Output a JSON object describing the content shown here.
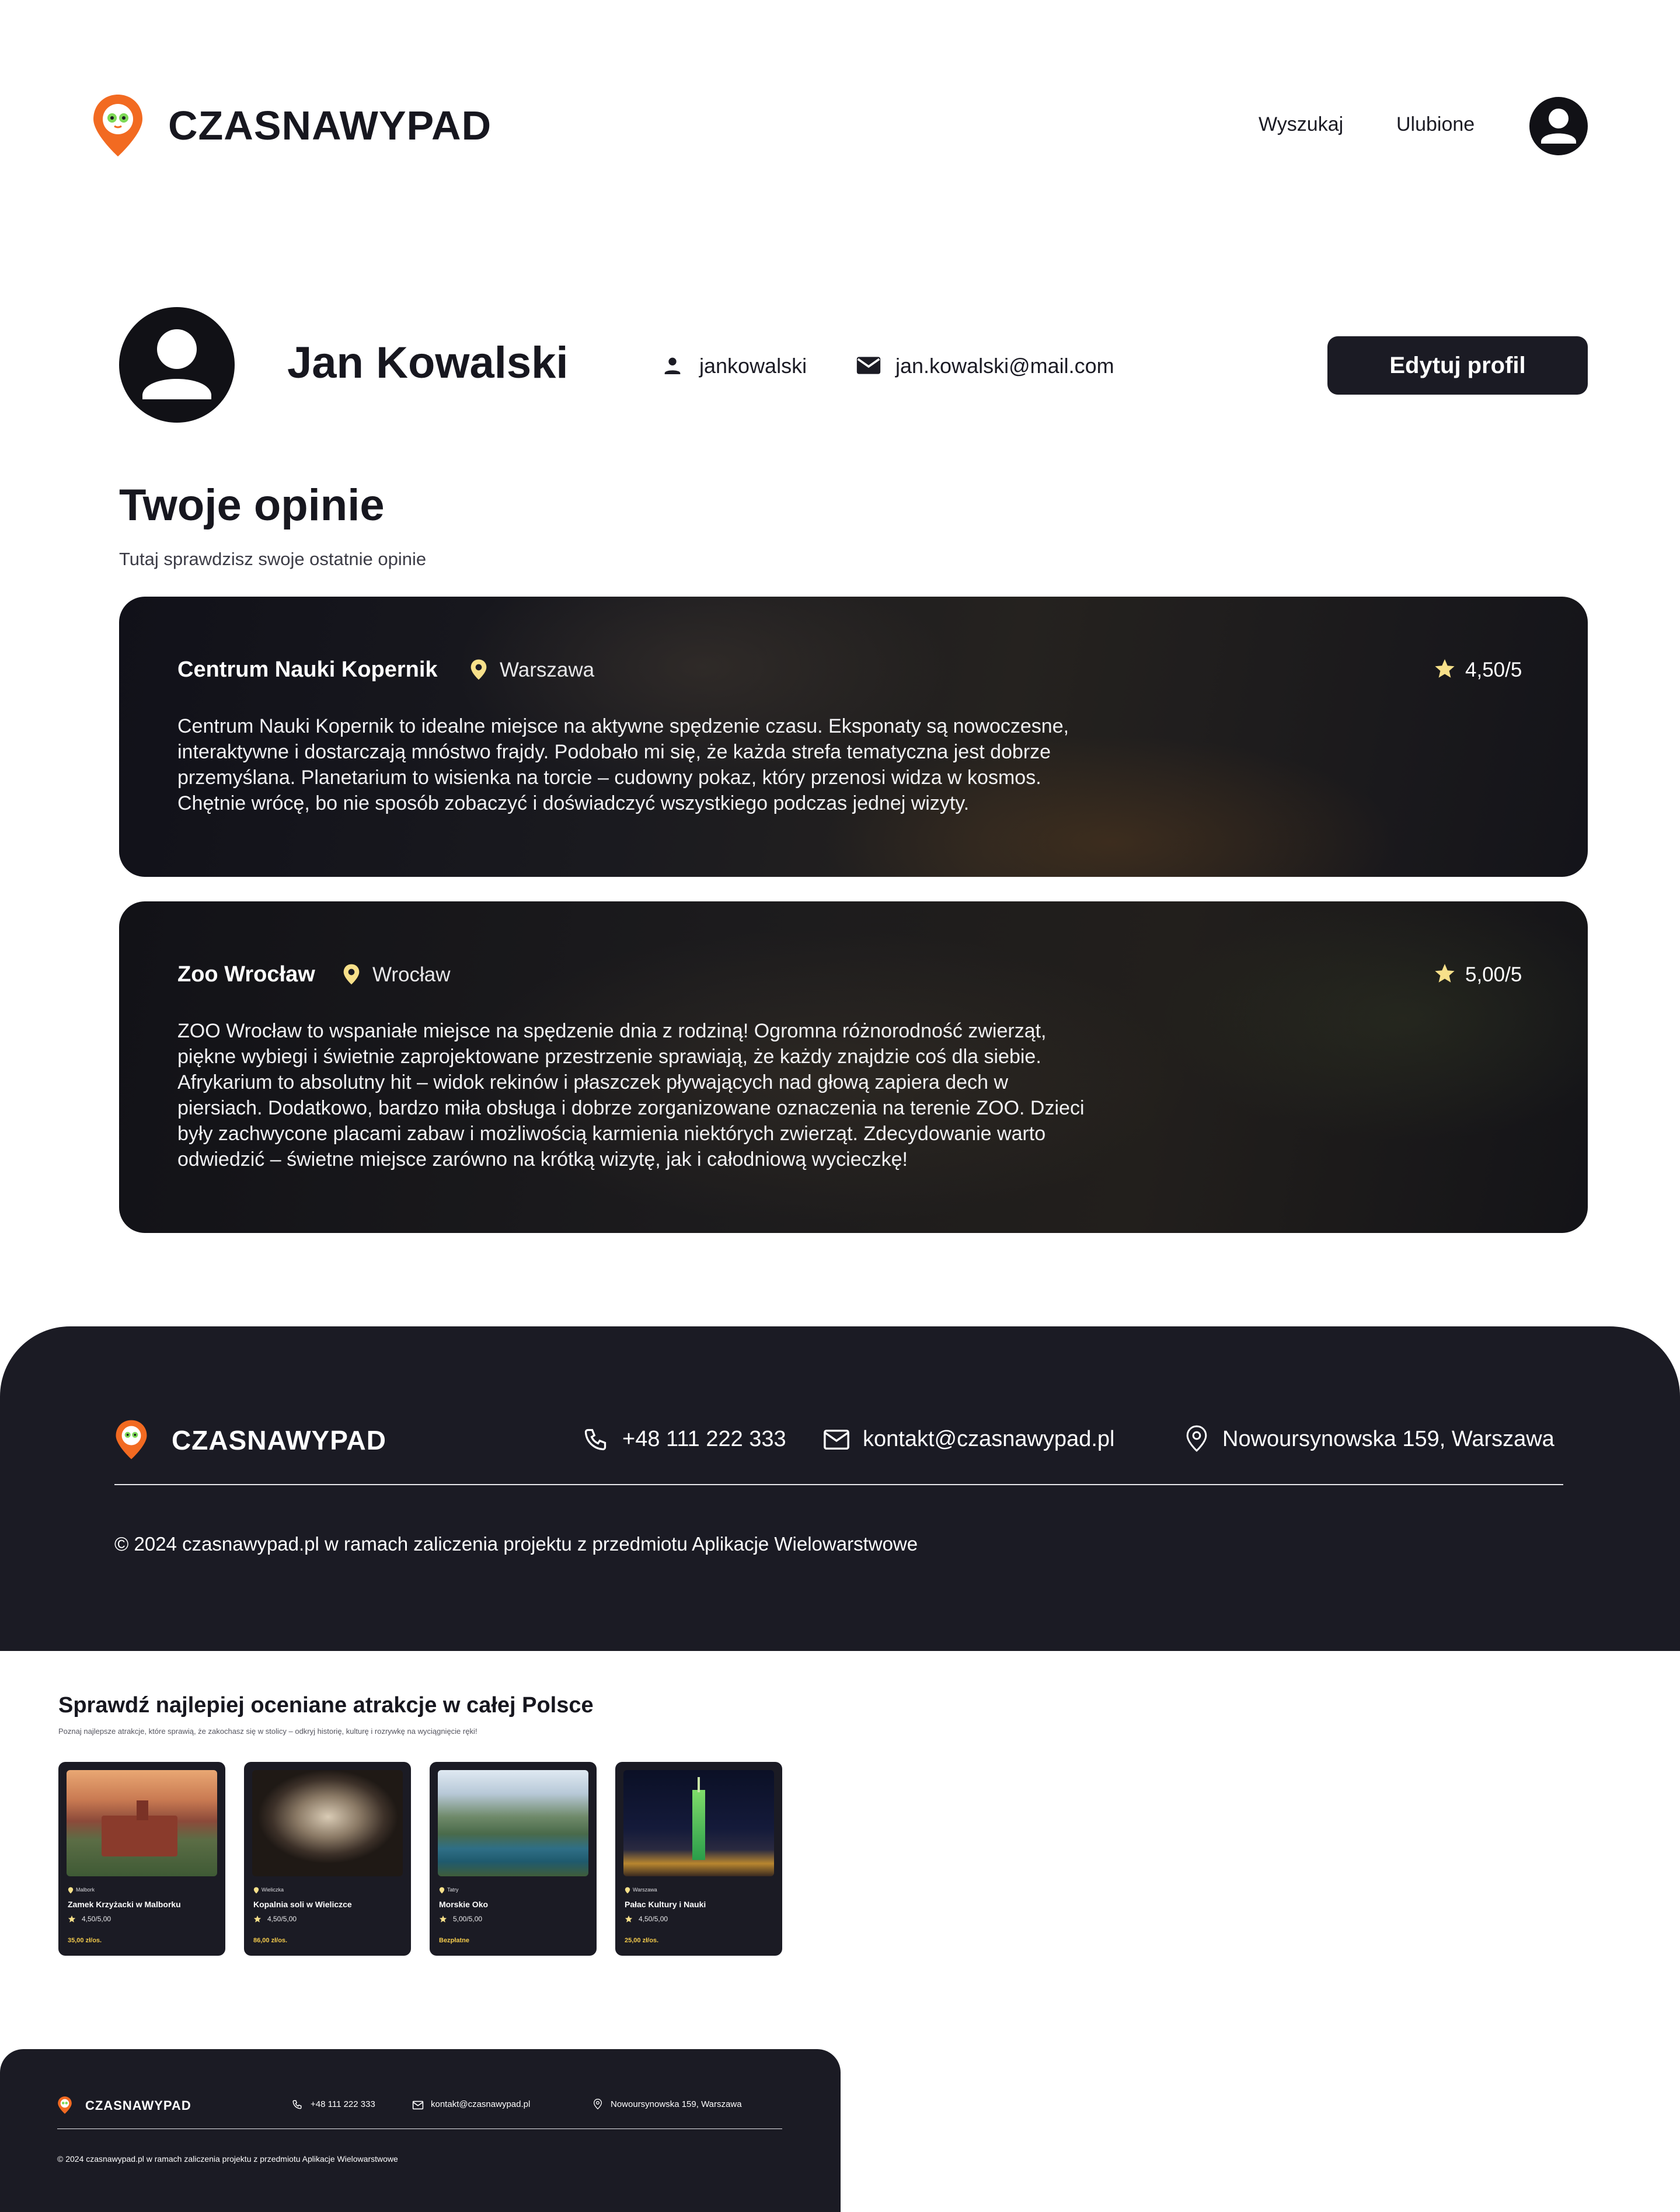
{
  "header": {
    "brand": "CZASNAWYPAD",
    "nav": [
      "Wyszukaj",
      "Ulubione"
    ]
  },
  "profile": {
    "name": "Jan Kowalski",
    "username": "jankowalski",
    "email": "jan.kowalski@mail.com",
    "edit_label": "Edytuj profil"
  },
  "reviews": {
    "title": "Twoje opinie",
    "subtitle": "Tutaj sprawdzisz swoje ostatnie opinie",
    "items": [
      {
        "name": "Centrum Nauki Kopernik",
        "city": "Warszawa",
        "rating": "4,50/5",
        "lines": [
          "Centrum Nauki Kopernik to idealne miejsce na aktywne spędzenie czasu. Eksponaty są nowoczesne,",
          "interaktywne i dostarczają mnóstwo frajdy. Podobało mi się, że każda strefa tematyczna jest dobrze",
          "przemyślana. Planetarium to wisienka na torcie – cudowny pokaz, który przenosi widza w kosmos.",
          "Chętnie wrócę, bo nie sposób zobaczyć i doświadczyć wszystkiego podczas jednej wizyty."
        ]
      },
      {
        "name": "Zoo Wrocław",
        "city": "Wrocław",
        "rating": "5,00/5",
        "lines": [
          "ZOO Wrocław to wspaniałe miejsce na spędzenie dnia z rodziną! Ogromna różnorodność zwierząt,",
          "piękne wybiegi i świetnie zaprojektowane przestrzenie sprawiają, że każdy znajdzie coś dla siebie.",
          "Afrykarium to absolutny hit – widok rekinów i płaszczek pływających nad głową zapiera dech w",
          "piersiach. Dodatkowo, bardzo miła obsługa i dobrze zorganizowane oznaczenia na terenie ZOO. Dzieci",
          "były zachwycone placami zabaw i możliwością karmienia niektórych zwierząt. Zdecydowanie warto",
          "odwiedzić – świetne miejsce zarówno na krótką wizytę, jak i całodniową wycieczkę!"
        ]
      }
    ]
  },
  "footer": {
    "brand": "CZASNAWYPAD",
    "phone": "+48 111 222 333",
    "email": "kontakt@czasnawypad.pl",
    "address": "Nowoursynowska 159, Warszawa",
    "copyright": "© 2024 czasnawypad.pl w ramach zaliczenia projektu z przedmiotu Aplikacje Wielowarstwowe"
  },
  "attractions": {
    "title": "Sprawdź najlepiej oceniane atrakcje w całej Polsce",
    "subtitle": "Poznaj najlepsze atrakcje, które sprawią, że zakochasz się w stolicy – odkryj historię, kulturę i rozrywkę na wyciągnięcie ręki!",
    "items": [
      {
        "city": "Malbork",
        "name": "Zamek Krzyżacki w Malborku",
        "rating": "4,50/5,00",
        "price": "35,00 zł/os."
      },
      {
        "city": "Wieliczka",
        "name": "Kopalnia soli w Wieliczce",
        "rating": "4,50/5,00",
        "price": "86,00 zł/os."
      },
      {
        "city": "Tatry",
        "name": "Morskie Oko",
        "rating": "5,00/5,00",
        "price": "Bezpłatne"
      },
      {
        "city": "Warszawa",
        "name": "Pałac Kultury i Nauki",
        "rating": "4,50/5,00",
        "price": "25,00 zł/os."
      }
    ]
  },
  "mini_footer": {
    "brand": "CZASNAWYPAD",
    "phone": "+48 111 222 333",
    "email": "kontakt@czasnawypad.pl",
    "address": "Nowoursynowska 159, Warszawa",
    "copyright": "© 2024 czasnawypad.pl w ramach zaliczenia projektu z przedmiotu Aplikacje Wielowarstwowe"
  },
  "colors": {
    "dark": "#1b1b24",
    "accent_orange": "#f26a21",
    "accent_green": "#7ed957",
    "star": "#f7e08a",
    "price": "#f2c94c"
  },
  "icons": [
    "logo-pin-icon",
    "user-avatar-icon",
    "person-icon",
    "mail-icon",
    "location-pin-icon",
    "star-icon",
    "phone-icon"
  ]
}
